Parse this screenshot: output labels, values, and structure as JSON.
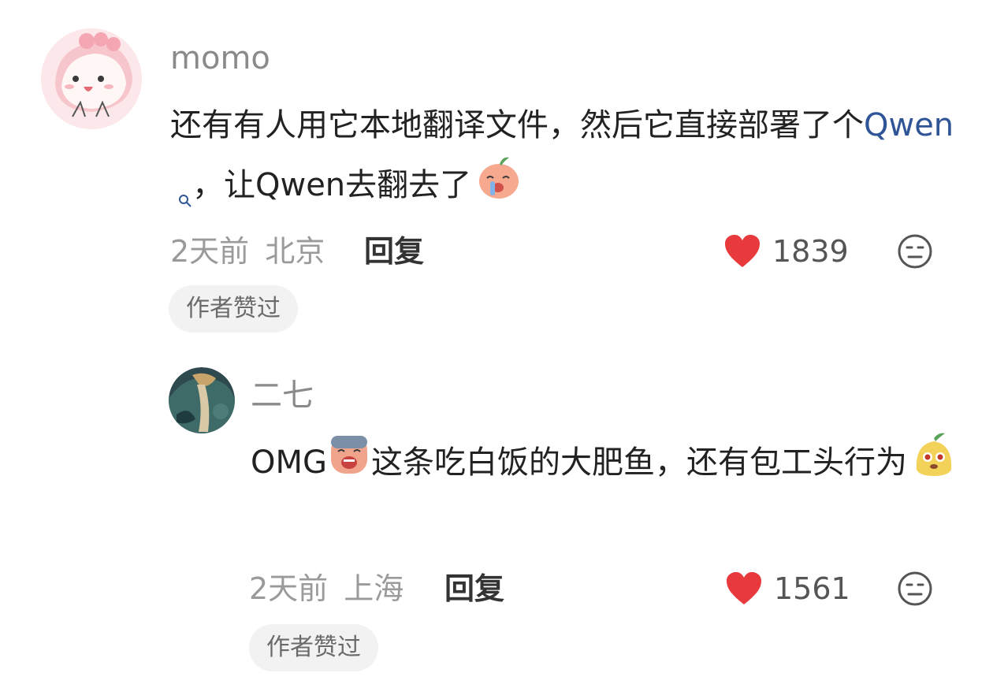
{
  "comments": [
    {
      "username": "momo",
      "text_before": "还有有人用它本地翻译文件，然后它直接部署了个",
      "link": "Qwen",
      "text_after": "，让Qwen去翻去了",
      "emoji_icon": "crying-face-sticker-icon",
      "time": "2天前",
      "location": "北京",
      "reply_label": "回复",
      "like_count": "1839",
      "badge": "作者赞过"
    },
    {
      "username": "二七",
      "text_before": "OMG",
      "emoji_icon_1": "shocked-face-sticker-icon",
      "text_mid": "这条吃白饭的大肥鱼，还有包工头行为",
      "emoji_icon_2": "sprout-face-sticker-icon",
      "time": "2天前",
      "location": "上海",
      "reply_label": "回复",
      "like_count": "1561",
      "badge": "作者赞过"
    }
  ],
  "colors": {
    "like": "#e8393c",
    "link": "#2f5597"
  }
}
